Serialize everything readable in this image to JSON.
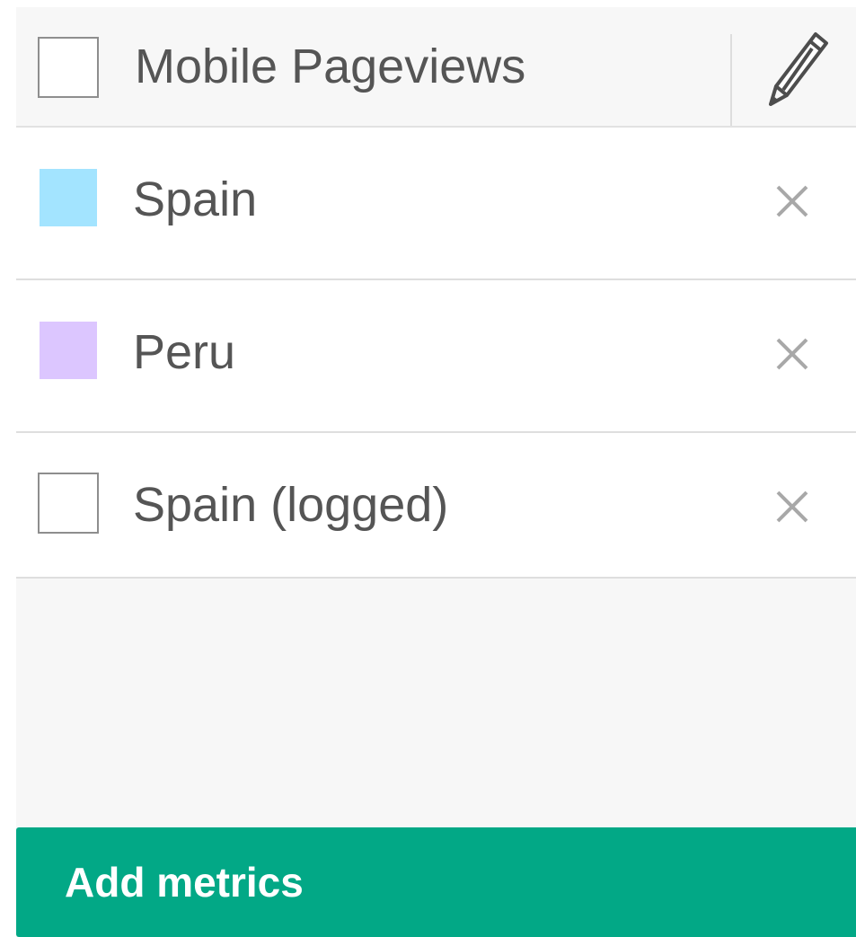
{
  "header": {
    "title": "Mobile Pageviews",
    "swatch_color": "#ffffff",
    "edit_icon": "pencil-icon"
  },
  "metrics": [
    {
      "label": "Spain",
      "color": "#a3e4ff",
      "remove_icon": "close-icon"
    },
    {
      "label": "Peru",
      "color": "#dcc6ff",
      "remove_icon": "close-icon"
    },
    {
      "label": "Spain (logged)",
      "color": "#ffffff",
      "remove_icon": "close-icon"
    }
  ],
  "actions": {
    "add_metrics_label": "Add metrics",
    "add_metrics_color": "#02a886"
  }
}
